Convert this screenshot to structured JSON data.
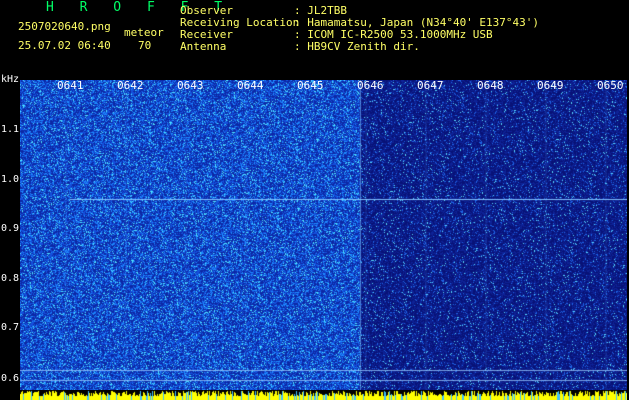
{
  "header": {
    "app_title": "H R O F F T",
    "filename": "2507020640.png",
    "meteor_label": "meteor",
    "datetime": "25.07.02 06:40",
    "meteor_count": "70",
    "info": [
      {
        "label": "Observer",
        "value": ": JL2TBB"
      },
      {
        "label": "Receiving Location",
        "value": ": Hamamatsu, Japan (N34°40' E137°43')"
      },
      {
        "label": "Receiver",
        "value": ": ICOM IC-R2500 53.1000MHz USB"
      },
      {
        "label": "Antenna",
        "value": ": HB9CV Zenith dir."
      }
    ]
  },
  "time_axis": {
    "labels": [
      "0641",
      "0642",
      "0643",
      "0644",
      "0645",
      "0646",
      "0647",
      "0648",
      "0649",
      "0650"
    ]
  },
  "freq_axis": {
    "unit": "kHz",
    "labels": [
      "1.1",
      "1.0",
      "0.9",
      "0.8",
      "0.7",
      "0.6"
    ]
  },
  "colors": {
    "title": "#00ff66",
    "text": "#ffff66",
    "tick": "#ffffff",
    "background": "#000000",
    "noise_high": "#1f7cff",
    "noise_low": "#0a1a8c",
    "carrier": "#80c0ff",
    "baseline": "#ffff00"
  }
}
